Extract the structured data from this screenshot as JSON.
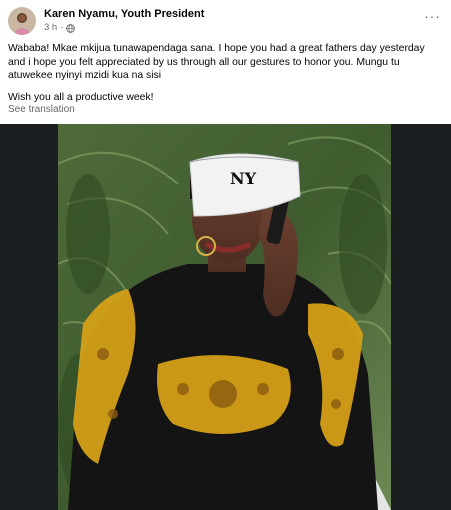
{
  "post": {
    "author": "Karen Nyamu, Youth President",
    "time": "3 h",
    "separator": "·",
    "privacy_icon": "globe-icon",
    "more_icon": "more-options-icon",
    "more_label": "···",
    "paragraphs": [
      "Wababa! Mkae mkijua tunawapendaga sana. I hope you had a great fathers day yesterday and i hope you felt appreciated by us through all our gestures to honor you. Mungu tu atuwekee nyinyi mzidi kua na sisi",
      "Wish you all a productive week!"
    ],
    "see_translation": "See translation",
    "cap_logo": "NY"
  },
  "colors": {
    "author_text": "#050505",
    "secondary_text": "#65676b",
    "photo_frame": "#1b1f22",
    "sweater": "#141414",
    "gold_pattern": "#d4a017"
  }
}
